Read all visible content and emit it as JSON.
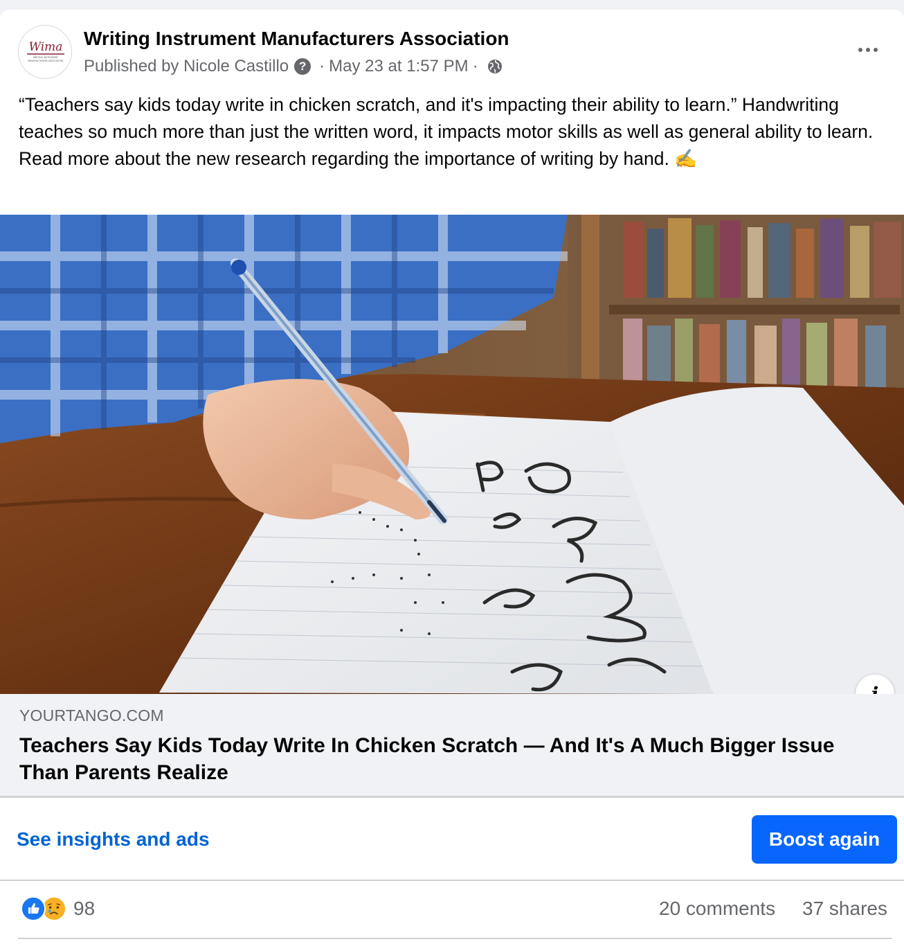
{
  "post": {
    "page_name": "Writing Instrument Manufacturers Association",
    "published_by": "Published by Nicole Castillo",
    "help_glyph": "?",
    "separator": "·",
    "timestamp": "May 23 at 1:57 PM",
    "privacy_icon": "globe-icon",
    "text": "“Teachers say kids today write in chicken scratch, and it's impacting their ability to learn.” Handwriting teaches so much more than just the written word, it impacts motor skills as well as general ability to learn. Read more about the new research regarding the importance of writing by hand. ✍️",
    "avatar_logo_text": "Wima",
    "avatar_subtext_1": "WRITING INSTRUMENT",
    "avatar_subtext_2": "MANUFACTURERS ASSOCIATION"
  },
  "link_preview": {
    "domain": "YOURTANGO.COM",
    "title": "Teachers Say Kids Today Write In Chicken Scratch — And It's A Much Bigger Issue Than Parents Realize",
    "info_glyph": "i"
  },
  "actions": {
    "insights_label": "See insights and ads",
    "boost_label": "Boost again"
  },
  "stats": {
    "reaction_count": "98",
    "reaction_icons": [
      "like-icon",
      "sad-icon"
    ],
    "comments": "20 comments",
    "shares": "37 shares"
  },
  "colors": {
    "accent_blue": "#0866ff",
    "link_blue": "#0064d1",
    "secondary_text": "#65676b"
  }
}
